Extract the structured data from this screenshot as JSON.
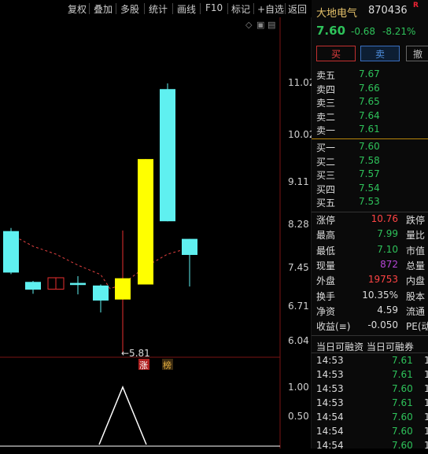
{
  "toolbar": {
    "items": [
      "复权",
      "叠加",
      "多股",
      "统计",
      "画线",
      "F10",
      "标记",
      "+自选",
      "返回"
    ]
  },
  "chart_data": {
    "type": "candlestick",
    "y_ticks": [
      "11.02",
      "10.02",
      "9.11",
      "8.28",
      "7.45",
      "6.71",
      "6.04"
    ],
    "candles": [
      {
        "open": 7.37,
        "close": 8.17,
        "high": 8.23,
        "low": 7.34,
        "color": "cyan"
      },
      {
        "open": 7.04,
        "close": 7.19,
        "high": 7.21,
        "low": 6.96,
        "color": "cyan"
      },
      {
        "open": 7.05,
        "close": 7.27,
        "high": 7.27,
        "low": 7.05,
        "color": "red"
      },
      {
        "open": 7.13,
        "close": 7.17,
        "high": 7.3,
        "low": 6.95,
        "color": "cyan"
      },
      {
        "open": 6.83,
        "close": 7.12,
        "high": 7.14,
        "low": 6.6,
        "color": "cyan"
      },
      {
        "open": 6.85,
        "close": 7.26,
        "high": 8.18,
        "low": 5.81,
        "color": "yellow"
      },
      {
        "open": 7.14,
        "close": 9.56,
        "high": 9.56,
        "low": 7.14,
        "color": "yellow"
      },
      {
        "open": 8.36,
        "close": 10.91,
        "high": 11.02,
        "low": 8.36,
        "color": "cyan"
      },
      {
        "open": 7.71,
        "close": 8.02,
        "high": 8.02,
        "low": 7.1,
        "color": "cyan"
      }
    ],
    "min_annotation": "←5.81",
    "markers": [
      "涨",
      "榜"
    ],
    "sub_y_ticks": [
      "1.00",
      "0.50"
    ],
    "sub_values": [
      0,
      0,
      0,
      0,
      0,
      1.0,
      0,
      0,
      0
    ]
  },
  "stock": {
    "name": "大地电气",
    "code": "870436",
    "badge": "R",
    "last": "7.60",
    "change": "-0.68",
    "change_pct": "-8.21%"
  },
  "buttons": {
    "buy": "买",
    "sell": "卖",
    "third": "撤"
  },
  "orderbook": {
    "asks": [
      {
        "label": "卖五",
        "price": "7.67"
      },
      {
        "label": "卖四",
        "price": "7.66"
      },
      {
        "label": "卖三",
        "price": "7.65"
      },
      {
        "label": "卖二",
        "price": "7.64"
      },
      {
        "label": "卖一",
        "price": "7.61"
      }
    ],
    "bids": [
      {
        "label": "买一",
        "price": "7.60"
      },
      {
        "label": "买二",
        "price": "7.58"
      },
      {
        "label": "买三",
        "price": "7.57"
      },
      {
        "label": "买四",
        "price": "7.54"
      },
      {
        "label": "买五",
        "price": "7.53"
      }
    ]
  },
  "stats": [
    {
      "label": "涨停",
      "value": "10.76",
      "color": "#ff4444",
      "right": "跌停"
    },
    {
      "label": "最高",
      "value": "7.99",
      "color": "#2ec25a",
      "right": "量比"
    },
    {
      "label": "最低",
      "value": "7.10",
      "color": "#2ec25a",
      "right": "市值"
    },
    {
      "label": "现量",
      "value": "872",
      "color": "#b545d6",
      "right": "总量"
    },
    {
      "label": "外盘",
      "value": "19753",
      "color": "#ff4444",
      "right": "内盘"
    },
    {
      "label": "换手",
      "value": "10.35%",
      "color": "#dddddd",
      "right": "股本"
    },
    {
      "label": "净资",
      "value": "4.59",
      "color": "#dddddd",
      "right": "流通"
    },
    {
      "label": "收益(≡)",
      "value": "-0.050",
      "color": "#dddddd",
      "right": "PE(动"
    }
  ],
  "margin_text": "当日可融资 当日可融券",
  "ticks": [
    {
      "time": "14:53",
      "price": "7.61",
      "vol": "1"
    },
    {
      "time": "14:53",
      "price": "7.61",
      "vol": "1"
    },
    {
      "time": "14:53",
      "price": "7.60",
      "vol": "1"
    },
    {
      "time": "14:53",
      "price": "7.61",
      "vol": "1"
    },
    {
      "time": "14:54",
      "price": "7.60",
      "vol": "1"
    },
    {
      "time": "14:54",
      "price": "7.60",
      "vol": "1"
    },
    {
      "time": "14:54",
      "price": "7.60",
      "vol": "1"
    }
  ]
}
